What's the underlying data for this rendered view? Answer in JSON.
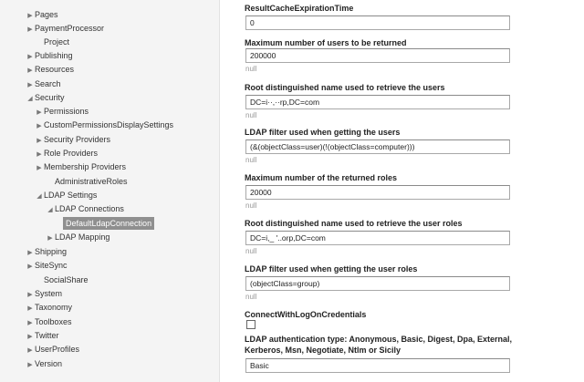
{
  "sidebar": {
    "items": [
      {
        "label": "Pages",
        "expanded": false
      },
      {
        "label": "PaymentProcessor",
        "expanded": false
      },
      {
        "label": "Project",
        "expanded": null
      },
      {
        "label": "Publishing",
        "expanded": false
      },
      {
        "label": "Resources",
        "expanded": false
      },
      {
        "label": "Search",
        "expanded": false
      },
      {
        "label": "Security",
        "expanded": true
      },
      {
        "label": "Permissions",
        "expanded": false
      },
      {
        "label": "CustomPermissionsDisplaySettings",
        "expanded": false
      },
      {
        "label": "Security Providers",
        "expanded": false
      },
      {
        "label": "Role Providers",
        "expanded": false
      },
      {
        "label": "Membership Providers",
        "expanded": false
      },
      {
        "label": "AdministrativeRoles",
        "expanded": null
      },
      {
        "label": "LDAP Settings",
        "expanded": true
      },
      {
        "label": "LDAP Connections",
        "expanded": true
      },
      {
        "label": "DefaultLdapConnection",
        "expanded": null,
        "selected": true
      },
      {
        "label": "LDAP Mapping",
        "expanded": false
      },
      {
        "label": "Shipping",
        "expanded": false
      },
      {
        "label": "SiteSync",
        "expanded": false
      },
      {
        "label": "SocialShare",
        "expanded": null
      },
      {
        "label": "System",
        "expanded": false
      },
      {
        "label": "Taxonomy",
        "expanded": false
      },
      {
        "label": "Toolboxes",
        "expanded": false
      },
      {
        "label": "Twitter",
        "expanded": false
      },
      {
        "label": "UserProfiles",
        "expanded": false
      },
      {
        "label": "Version",
        "expanded": false
      }
    ]
  },
  "fields": [
    {
      "label": "ResultCacheExpirationTime",
      "value": "0",
      "hint": ""
    },
    {
      "label": "Maximum number of users to be returned",
      "value": "200000",
      "hint": "null"
    },
    {
      "label": "Root distinguished name used to retrieve the users",
      "value": "DC=i··,··rp,DC=com",
      "hint": "null"
    },
    {
      "label": "LDAP filter used when getting the users",
      "value": "(&(objectClass=user)(!(objectClass=computer)))",
      "hint": "null"
    },
    {
      "label": "Maximum number of the returned roles",
      "value": "20000",
      "hint": "null"
    },
    {
      "label": "Root distinguished name used to retrieve the user roles",
      "value": "DC=i,_ '..orp,DC=com",
      "hint": "null"
    },
    {
      "label": "LDAP filter used when getting the user roles",
      "value": "(objectClass=group)",
      "hint": "null"
    }
  ],
  "checkbox_field": {
    "label": "ConnectWithLogOnCredentials",
    "checked": false
  },
  "auth_field": {
    "label_line1": "LDAP authentication type: Anonymous, Basic, Digest, Dpa, External,",
    "label_line2": "Kerberos, Msn, Negotiate, Ntlm or Sicily",
    "value": "Basic"
  }
}
